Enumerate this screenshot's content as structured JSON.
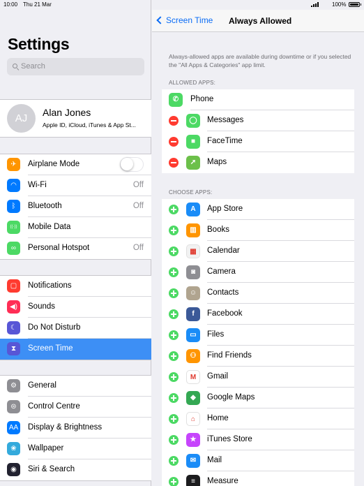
{
  "status": {
    "time": "10:00",
    "date": "Thu 21 Mar",
    "battery": "100%"
  },
  "master": {
    "title": "Settings",
    "search_placeholder": "Search",
    "profile": {
      "initials": "AJ",
      "name": "Alan Jones",
      "subtitle": "Apple ID, iCloud, iTunes & App St..."
    },
    "group1": [
      {
        "label": "Airplane Mode",
        "value": "",
        "icon": "airplane-icon",
        "color": "#ff9500",
        "glyph": "✈",
        "toggle": true
      },
      {
        "label": "Wi-Fi",
        "value": "Off",
        "icon": "wifi-icon",
        "color": "#007aff",
        "glyph": "◠"
      },
      {
        "label": "Bluetooth",
        "value": "Off",
        "icon": "bluetooth-icon",
        "color": "#007aff",
        "glyph": "ᛒ"
      },
      {
        "label": "Mobile Data",
        "value": "",
        "icon": "antenna-icon",
        "color": "#4cd964",
        "glyph": "((·))"
      },
      {
        "label": "Personal Hotspot",
        "value": "Off",
        "icon": "hotspot-icon",
        "color": "#4cd964",
        "glyph": "∞"
      }
    ],
    "group2": [
      {
        "label": "Notifications",
        "icon": "notifications-icon",
        "color": "#ff3b30",
        "glyph": "▢"
      },
      {
        "label": "Sounds",
        "icon": "speaker-icon",
        "color": "#ff2d55",
        "glyph": "◀)"
      },
      {
        "label": "Do Not Disturb",
        "icon": "moon-icon",
        "color": "#5856d6",
        "glyph": "☾"
      },
      {
        "label": "Screen Time",
        "icon": "hourglass-icon",
        "color": "#5856d6",
        "glyph": "⧗",
        "selected": true
      }
    ],
    "group3": [
      {
        "label": "General",
        "icon": "gear-icon",
        "color": "#8e8e93",
        "glyph": "⚙"
      },
      {
        "label": "Control Centre",
        "icon": "switches-icon",
        "color": "#8e8e93",
        "glyph": "⊜"
      },
      {
        "label": "Display & Brightness",
        "icon": "display-icon",
        "color": "#007aff",
        "glyph": "AA"
      },
      {
        "label": "Wallpaper",
        "icon": "wallpaper-icon",
        "color": "#34aadc",
        "glyph": "❀"
      },
      {
        "label": "Siri & Search",
        "icon": "siri-icon",
        "color": "#222230",
        "glyph": "◉"
      }
    ]
  },
  "detail": {
    "back_label": "Screen Time",
    "title": "Always Allowed",
    "explanation": "Always-allowed apps are available during downtime or if you selected the \"All Apps & Categories\" app limit.",
    "allowed_header": "ALLOWED APPS:",
    "allowed": [
      {
        "label": "Phone",
        "icon": "phone-icon",
        "color": "#4cd964",
        "glyph": "✆",
        "removable": false
      },
      {
        "label": "Messages",
        "icon": "messages-icon",
        "color": "#4cd964",
        "glyph": "◯",
        "removable": true
      },
      {
        "label": "FaceTime",
        "icon": "facetime-icon",
        "color": "#4cd964",
        "glyph": "■",
        "removable": true
      },
      {
        "label": "Maps",
        "icon": "maps-icon",
        "color": "#6cc04a",
        "glyph": "➚",
        "removable": true
      }
    ],
    "choose_header": "CHOOSE APPS:",
    "choose": [
      {
        "label": "App Store",
        "icon": "app-store-icon",
        "color": "#1a8cf7",
        "glyph": "A"
      },
      {
        "label": "Books",
        "icon": "books-icon",
        "color": "#ff9500",
        "glyph": "▥"
      },
      {
        "label": "Calendar",
        "icon": "calendar-icon",
        "color": "#f2f2f2",
        "glyph": "▦"
      },
      {
        "label": "Camera",
        "icon": "camera-icon",
        "color": "#8e8e93",
        "glyph": "◙"
      },
      {
        "label": "Contacts",
        "icon": "contacts-icon",
        "color": "#b0a48f",
        "glyph": "☺"
      },
      {
        "label": "Facebook",
        "icon": "facebook-icon",
        "color": "#3b5998",
        "glyph": "f"
      },
      {
        "label": "Files",
        "icon": "files-icon",
        "color": "#1a8cf7",
        "glyph": "▭"
      },
      {
        "label": "Find Friends",
        "icon": "find-friends-icon",
        "color": "#ff9500",
        "glyph": "⚇"
      },
      {
        "label": "Gmail",
        "icon": "gmail-icon",
        "color": "#ffffff",
        "glyph": "M"
      },
      {
        "label": "Google Maps",
        "icon": "google-maps-icon",
        "color": "#34a853",
        "glyph": "◆"
      },
      {
        "label": "Home",
        "icon": "home-icon",
        "color": "#ffffff",
        "glyph": "⌂"
      },
      {
        "label": "iTunes Store",
        "icon": "itunes-store-icon",
        "color": "#c644fc",
        "glyph": "★"
      },
      {
        "label": "Mail",
        "icon": "mail-icon",
        "color": "#1a8cf7",
        "glyph": "✉"
      },
      {
        "label": "Measure",
        "icon": "measure-icon",
        "color": "#1c1c1e",
        "glyph": "≡"
      }
    ]
  }
}
